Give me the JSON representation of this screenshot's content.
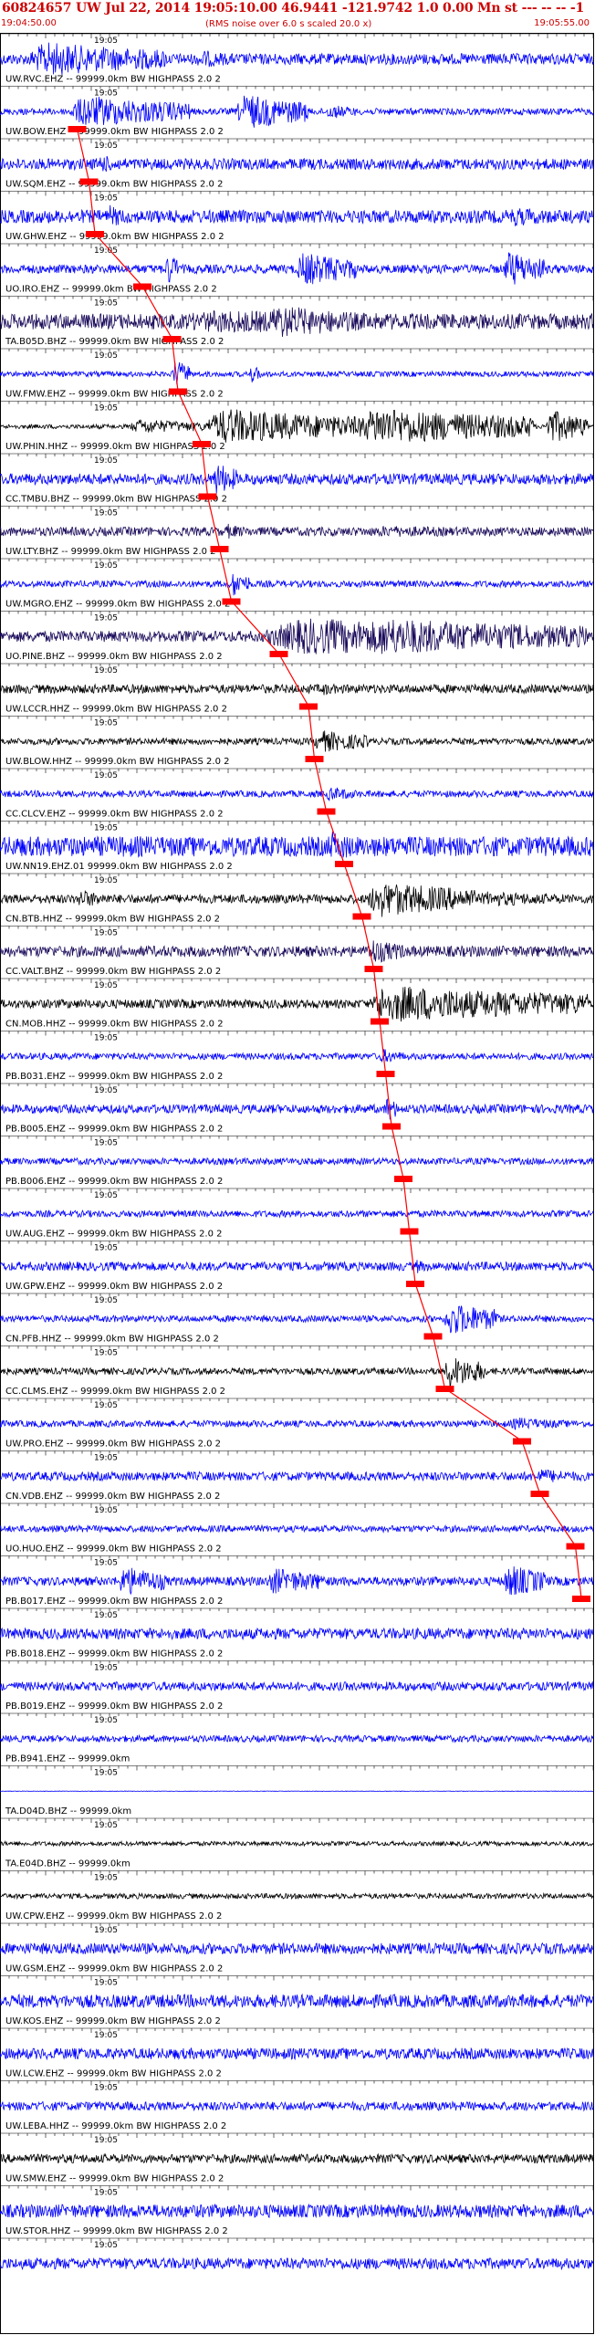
{
  "header": {
    "title": "60824657 UW Jul 22, 2014 19:05:10.00   46.9441 -121.9742  1.0 0.00 Mn st --- -- --  -1",
    "start_time": "19:04:50.00",
    "rms_note": "(RMS noise over 6.0 s scaled 20.0 x)",
    "end_time": "19:05:55.00"
  },
  "colors": {
    "blue": "#0000ff",
    "black": "#000000",
    "navy": "#1a0a5a",
    "pick": "#ff0000",
    "text": "#cc0000"
  },
  "chart_data": {
    "type": "line",
    "title": "60824657 UW Jul 22, 2014 19:05:10.00   46.9441 -121.9742  1.0 0.00 Mn st --- -- --  -1",
    "x_range": [
      "19:04:50.00",
      "19:05:55.00"
    ],
    "time_label": "19:05",
    "series": [
      {
        "label": "UW.RVC.EHZ -- 99999.0km BW  HIGHPASS  2.0  2",
        "color": "blue",
        "noise": 0.25,
        "bursts": [
          [
            0.05,
            0.28,
            0.9
          ],
          [
            0.33,
            0.4,
            0.5
          ],
          [
            0.72,
            0.9,
            0.25
          ]
        ],
        "pick": null
      },
      {
        "label": "UW.BOW.EHZ -- 99999.0km BW  HIGHPASS  2.0  2",
        "color": "blue",
        "noise": 0.15,
        "bursts": [
          [
            0.12,
            0.32,
            0.85
          ],
          [
            0.4,
            0.52,
            0.95
          ],
          [
            0.55,
            0.6,
            0.4
          ]
        ],
        "pick": 0.13
      },
      {
        "label": "UW.SQM.EHZ -- 99999.0km BW  HIGHPASS  2.0  2",
        "color": "blue",
        "noise": 0.25,
        "bursts": [
          [
            0.16,
            0.22,
            0.5
          ],
          [
            0.5,
            0.7,
            0.3
          ]
        ],
        "pick": 0.15
      },
      {
        "label": "UW.GHW.EHZ -- 99999.0km BW  HIGHPASS  2.0  2",
        "color": "blue",
        "noise": 0.3,
        "bursts": [
          [
            0.18,
            0.22,
            0.6
          ],
          [
            0.85,
            0.99,
            0.5
          ]
        ],
        "pick": 0.16
      },
      {
        "label": "UO.IRO.EHZ -- 99999.0km BW  HIGHPASS  2.0  2",
        "color": "blue",
        "noise": 0.2,
        "bursts": [
          [
            0.28,
            0.3,
            0.95
          ],
          [
            0.5,
            0.6,
            0.9
          ],
          [
            0.85,
            0.92,
            0.95
          ]
        ],
        "pick": 0.24
      },
      {
        "label": "TA.B05D.BHZ -- 99999.0km BW  HIGHPASS  2.0  2",
        "color": "navy",
        "noise": 0.35,
        "bursts": [
          [
            0.28,
            0.99,
            0.6
          ],
          [
            0.45,
            0.6,
            0.9
          ]
        ],
        "pick": 0.29
      },
      {
        "label": "UW.FMW.EHZ -- 99999.0km BW  HIGHPASS  2.0  2",
        "color": "blue",
        "noise": 0.12,
        "bursts": [
          [
            0.29,
            0.32,
            0.8
          ],
          [
            0.42,
            0.44,
            0.5
          ]
        ],
        "pick": 0.3
      },
      {
        "label": "UW.PHIN.HHZ -- 99999.0km BW  HIGHPASS  2.0  2",
        "color": "black",
        "noise": 0.1,
        "bursts": [
          [
            0.22,
            0.35,
            0.4
          ],
          [
            0.35,
            0.6,
            0.95
          ],
          [
            0.6,
            0.9,
            0.98
          ],
          [
            0.92,
            0.99,
            0.9
          ]
        ],
        "pick": 0.34
      },
      {
        "label": "CC.TMBU.BHZ -- 99999.0km BW  HIGHPASS  2.0  2",
        "color": "blue",
        "noise": 0.25,
        "bursts": [
          [
            0.36,
            0.4,
            0.9
          ]
        ],
        "pick": 0.35
      },
      {
        "label": "UW.LTY.BHZ -- 99999.0km BW  HIGHPASS  2.0  2",
        "color": "navy",
        "noise": 0.2,
        "bursts": [
          [
            0.38,
            0.42,
            0.4
          ],
          [
            0.6,
            0.99,
            0.3
          ]
        ],
        "pick": 0.37
      },
      {
        "label": "UW.MGRO.EHZ -- 99999.0km BW  HIGHPASS  2.0  2",
        "color": "blue",
        "noise": 0.15,
        "bursts": [
          [
            0.39,
            0.42,
            0.7
          ]
        ],
        "pick": 0.39
      },
      {
        "label": "UO.PINE.BHZ -- 99999.0km BW  HIGHPASS  2.0  2",
        "color": "navy",
        "noise": 0.25,
        "bursts": [
          [
            0.45,
            0.99,
            0.95
          ],
          [
            0.6,
            0.99,
            0.99
          ]
        ],
        "pick": 0.47
      },
      {
        "label": "UW.LCCR.HHZ -- 99999.0km BW  HIGHPASS  2.0  2",
        "color": "black",
        "noise": 0.2,
        "bursts": [
          [
            0.54,
            0.58,
            0.35
          ]
        ],
        "pick": 0.52
      },
      {
        "label": "UW.BLOW.HHZ -- 99999.0km BW  HIGHPASS  2.0  2",
        "color": "black",
        "noise": 0.15,
        "bursts": [
          [
            0.53,
            0.62,
            0.6
          ]
        ],
        "pick": 0.53
      },
      {
        "label": "CC.CLCV.EHZ -- 99999.0km BW  HIGHPASS  2.0  2",
        "color": "blue",
        "noise": 0.15,
        "bursts": [
          [
            0.55,
            0.6,
            0.4
          ]
        ],
        "pick": 0.55
      },
      {
        "label": "UW.NN19.EHZ.01 99999.0km BW  HIGHPASS  2.0  2",
        "color": "blue",
        "noise": 0.45,
        "bursts": [
          [
            0.1,
            0.99,
            0.55
          ],
          [
            0.55,
            0.62,
            0.8
          ]
        ],
        "pick": 0.58
      },
      {
        "label": "CN.BTB.HHZ -- 99999.0km BW  HIGHPASS  2.0  2",
        "color": "black",
        "noise": 0.2,
        "bursts": [
          [
            0.13,
            0.18,
            0.5
          ],
          [
            0.62,
            0.8,
            0.95
          ],
          [
            0.8,
            0.99,
            0.4
          ]
        ],
        "pick": 0.61
      },
      {
        "label": "CC.VALT.BHZ -- 99999.0km BW  HIGHPASS  2.0  2",
        "color": "navy",
        "noise": 0.25,
        "bursts": [
          [
            0.62,
            0.68,
            0.7
          ]
        ],
        "pick": 0.63
      },
      {
        "label": "CN.MOB.HHZ -- 99999.0km BW  HIGHPASS  2.0  2",
        "color": "black",
        "noise": 0.2,
        "bursts": [
          [
            0.63,
            0.99,
            0.95
          ],
          [
            0.63,
            0.7,
            0.99
          ]
        ],
        "pick": 0.64
      },
      {
        "label": "PB.B031.EHZ -- 99999.0km BW  HIGHPASS  2.0  2",
        "color": "blue",
        "noise": 0.15,
        "bursts": [
          [
            0.64,
            0.68,
            0.4
          ]
        ],
        "pick": 0.65
      },
      {
        "label": "PB.B005.EHZ -- 99999.0km BW  HIGHPASS  2.0  2",
        "color": "blue",
        "noise": 0.2,
        "bursts": [
          [
            0.65,
            0.67,
            0.7
          ]
        ],
        "pick": 0.66
      },
      {
        "label": "PB.B006.EHZ -- 99999.0km BW  HIGHPASS  2.0  2",
        "color": "blue",
        "noise": 0.15,
        "bursts": [],
        "pick": 0.68
      },
      {
        "label": "UW.AUG.EHZ -- 99999.0km BW  HIGHPASS  2.0  2",
        "color": "blue",
        "noise": 0.15,
        "bursts": [],
        "pick": 0.69
      },
      {
        "label": "UW.GPW.EHZ -- 99999.0km BW  HIGHPASS  2.0  2",
        "color": "blue",
        "noise": 0.2,
        "bursts": [
          [
            0.7,
            0.72,
            0.4
          ]
        ],
        "pick": 0.7
      },
      {
        "label": "CN.PFB.HHZ -- 99999.0km BW  HIGHPASS  2.0  2",
        "color": "blue",
        "noise": 0.15,
        "bursts": [
          [
            0.75,
            0.84,
            0.9
          ]
        ],
        "pick": 0.73
      },
      {
        "label": "CC.CLMS.EHZ -- 99999.0km BW  HIGHPASS  2.0  2",
        "color": "black",
        "noise": 0.15,
        "bursts": [
          [
            0.75,
            0.82,
            0.85
          ]
        ],
        "pick": 0.75
      },
      {
        "label": "UW.PRO.EHZ -- 99999.0km BW  HIGHPASS  2.0  2",
        "color": "blue",
        "noise": 0.15,
        "bursts": [
          [
            0.86,
            0.95,
            0.35
          ]
        ],
        "pick": 0.88
      },
      {
        "label": "CN.VDB.EHZ -- 99999.0km BW  HIGHPASS  2.0  2",
        "color": "blue",
        "noise": 0.2,
        "bursts": [
          [
            0.9,
            0.99,
            0.4
          ]
        ],
        "pick": 0.91
      },
      {
        "label": "UO.HUO.EHZ -- 99999.0km BW  HIGHPASS  2.0  2",
        "color": "blue",
        "noise": 0.15,
        "bursts": [],
        "pick": 0.97
      },
      {
        "label": "PB.B017.EHZ -- 99999.0km BW  HIGHPASS  2.0  2",
        "color": "blue",
        "noise": 0.2,
        "bursts": [
          [
            0.2,
            0.28,
            0.8
          ],
          [
            0.45,
            0.55,
            0.7
          ],
          [
            0.85,
            0.92,
            0.9
          ]
        ],
        "pick": 0.98
      },
      {
        "label": "PB.B018.EHZ -- 99999.0km BW  HIGHPASS  2.0  2",
        "color": "blue",
        "noise": 0.25,
        "bursts": [],
        "pick": null
      },
      {
        "label": "PB.B019.EHZ -- 99999.0km BW  HIGHPASS  2.0  2",
        "color": "blue",
        "noise": 0.2,
        "bursts": [],
        "pick": null
      },
      {
        "label": "PB.B941.EHZ -- 99999.0km",
        "color": "blue",
        "noise": 0.15,
        "bursts": [],
        "pick": null
      },
      {
        "label": "TA.D04D.BHZ -- 99999.0km",
        "color": "blue",
        "noise": 0.01,
        "bursts": [],
        "pick": null
      },
      {
        "label": "TA.E04D.BHZ -- 99999.0km",
        "color": "black",
        "noise": 0.1,
        "bursts": [],
        "pick": null
      },
      {
        "label": "UW.CPW.EHZ -- 99999.0km BW  HIGHPASS  2.0  2",
        "color": "black",
        "noise": 0.12,
        "bursts": [],
        "pick": null
      },
      {
        "label": "UW.GSM.EHZ -- 99999.0km BW  HIGHPASS  2.0  2",
        "color": "blue",
        "noise": 0.25,
        "bursts": [],
        "pick": null
      },
      {
        "label": "UW.KOS.EHZ -- 99999.0km BW  HIGHPASS  2.0  2",
        "color": "blue",
        "noise": 0.3,
        "bursts": [],
        "pick": null
      },
      {
        "label": "UW.LCW.EHZ -- 99999.0km BW  HIGHPASS  2.0  2",
        "color": "blue",
        "noise": 0.25,
        "bursts": [],
        "pick": null
      },
      {
        "label": "UW.LEBA.HHZ -- 99999.0km BW  HIGHPASS  2.0  2",
        "color": "blue",
        "noise": 0.2,
        "bursts": [],
        "pick": null
      },
      {
        "label": "UW.SMW.EHZ -- 99999.0km BW  HIGHPASS  2.0  2",
        "color": "black",
        "noise": 0.2,
        "bursts": [],
        "pick": null
      },
      {
        "label": "UW.STOR.HHZ -- 99999.0km BW  HIGHPASS  2.0  2",
        "color": "blue",
        "noise": 0.3,
        "bursts": [],
        "pick": null
      },
      {
        "label": "",
        "color": "blue",
        "noise": 0.25,
        "bursts": [],
        "pick": null
      }
    ]
  }
}
